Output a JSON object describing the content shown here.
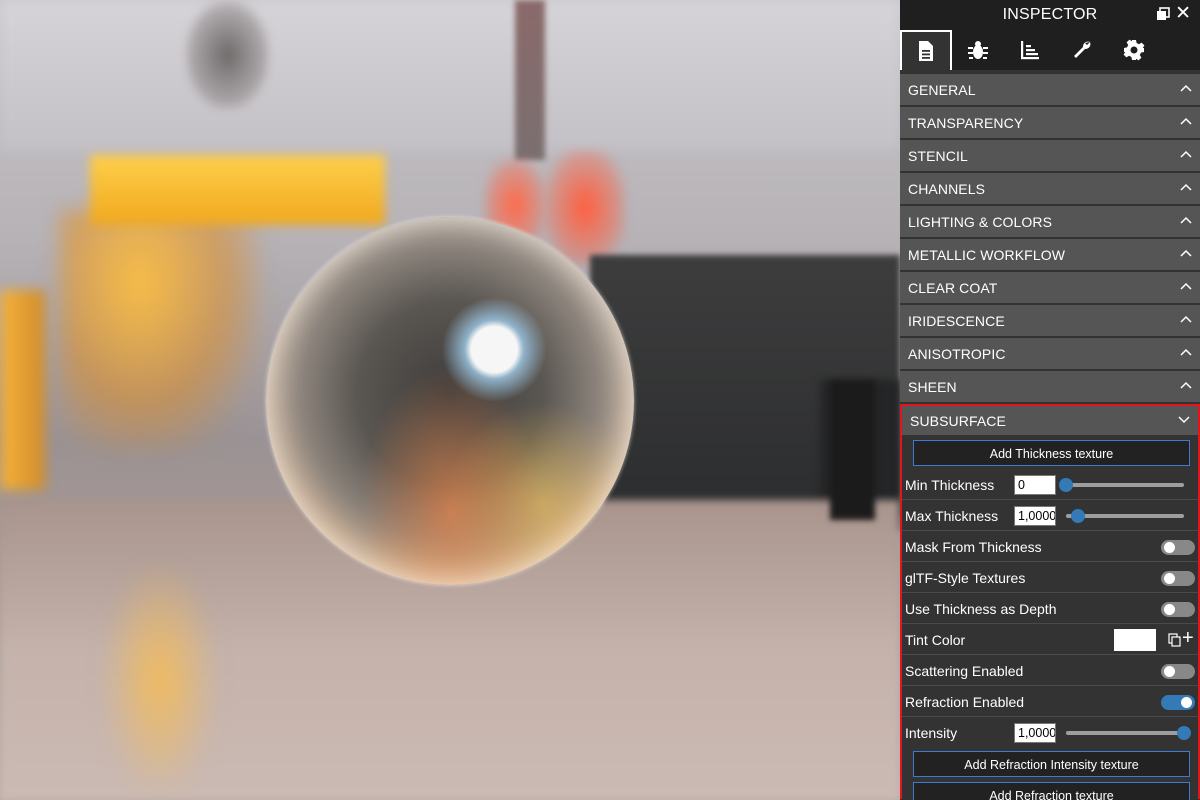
{
  "inspector": {
    "title": "INSPECTOR",
    "close_glyph": "✕",
    "icons": {
      "popout": "popout-icon",
      "close": "close-icon"
    },
    "tabs": [
      {
        "name": "properties",
        "icon": "document-icon",
        "active": true
      },
      {
        "name": "debug",
        "icon": "bug-icon",
        "active": false
      },
      {
        "name": "statistics",
        "icon": "chart-icon",
        "active": false
      },
      {
        "name": "tools",
        "icon": "wrench-icon",
        "active": false
      },
      {
        "name": "settings",
        "icon": "gear-icon",
        "active": false
      }
    ],
    "sections": [
      {
        "label": "GENERAL",
        "expanded": false
      },
      {
        "label": "TRANSPARENCY",
        "expanded": false
      },
      {
        "label": "STENCIL",
        "expanded": false
      },
      {
        "label": "CHANNELS",
        "expanded": false
      },
      {
        "label": "LIGHTING & COLORS",
        "expanded": false
      },
      {
        "label": "METALLIC WORKFLOW",
        "expanded": false
      },
      {
        "label": "CLEAR COAT",
        "expanded": false
      },
      {
        "label": "IRIDESCENCE",
        "expanded": false
      },
      {
        "label": "ANISOTROPIC",
        "expanded": false
      },
      {
        "label": "SHEEN",
        "expanded": false
      }
    ],
    "subsurface": {
      "label": "SUBSURFACE",
      "expanded": true,
      "add_thickness_texture": "Add Thickness texture",
      "min_thickness": {
        "label": "Min Thickness",
        "value": "0",
        "slider_fraction": 0.0
      },
      "max_thickness": {
        "label": "Max Thickness",
        "value": "1,0000",
        "slider_fraction": 0.1
      },
      "mask_from_thickness": {
        "label": "Mask From Thickness",
        "enabled": false
      },
      "gltf_style_textures": {
        "label": "glTF-Style Textures",
        "enabled": false
      },
      "use_thickness_as_depth": {
        "label": "Use Thickness as Depth",
        "enabled": false
      },
      "tint_color": {
        "label": "Tint Color",
        "color": "#ffffff",
        "plus_glyph": "+"
      },
      "scattering_enabled": {
        "label": "Scattering Enabled",
        "enabled": false
      },
      "refraction_enabled": {
        "label": "Refraction Enabled",
        "enabled": true
      },
      "intensity": {
        "label": "Intensity",
        "value": "1,0000",
        "slider_fraction": 1.0
      },
      "add_refraction_intensity_texture": "Add Refraction Intensity texture",
      "add_refraction_texture": "Add Refraction texture"
    },
    "colors": {
      "accent": "#337ab7",
      "highlight_border": "#e0161c",
      "section_bg": "#555555",
      "panel_bg": "#333333"
    }
  }
}
